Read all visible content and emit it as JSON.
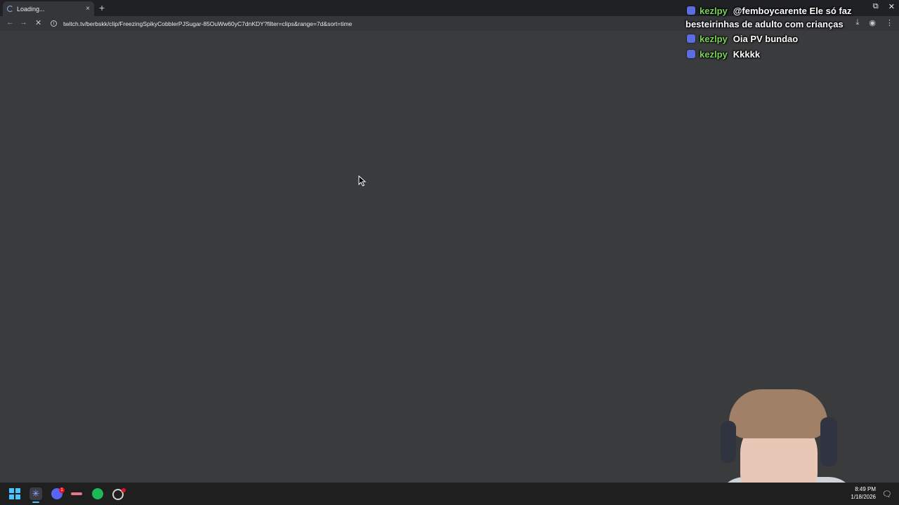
{
  "browser": {
    "tab_title": "Loading...",
    "tab_close": "×",
    "new_tab": "+",
    "url": "twitch.tv/berbskk/clip/FreezingSpikyCobblerPJSugar-85OuWw60yC7dnKDY?filter=clips&range=7d&sort=time",
    "back": "←",
    "forward": "→",
    "stop": "✕",
    "window_controls": {
      "restore": "⧉",
      "close": "✕"
    },
    "toolbar_icons": {
      "download": "⤓",
      "profile": "◉",
      "menu": "⋮"
    }
  },
  "chat": {
    "messages": [
      {
        "user": "kezlpy",
        "text": "@femboycarente Ele só faz besteirinhas de adulto com crianças"
      },
      {
        "user": "kezlpy",
        "text": "Oia PV bundao"
      },
      {
        "user": "kezlpy",
        "text": "Kkkkk"
      }
    ]
  },
  "taskbar": {
    "discord_badge": "1",
    "time": "8:49 PM",
    "date": "1/18/2026",
    "notification_icon": "🗨"
  },
  "colors": {
    "page_bg": "#3a3b3d",
    "chrome_bg": "#202124",
    "username": "#7bd45a",
    "accent": "#4cc2ff"
  }
}
